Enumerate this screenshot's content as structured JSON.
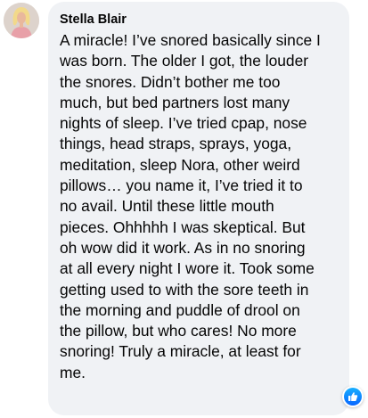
{
  "comment": {
    "author": "Stella Blair",
    "text_lines": [
      "A miracle! I’ve snored basically since I",
      "was born. The older I got, the louder",
      "the snores. Didn’t bother me too",
      "much, but bed partners lost many",
      "nights of sleep. I’ve tried cpap, nose",
      "things, head straps, sprays, yoga,",
      "meditation, sleep Nora, other weird",
      "pillows… you name it, I’ve tried it to",
      "no avail. Until these little mouth",
      "pieces. Ohhhhh I was skeptical. But",
      "oh wow did it work. As in no snoring",
      "at all every night I wore it. Took some",
      "getting used to with the sore teeth in",
      "the morning and puddle of drool on",
      "the pillow, but who cares! No more",
      "snoring! Truly a miracle, at least for",
      "me."
    ],
    "avatar_icon": "profile-photo",
    "reaction_icon": "like-thumbs-up-icon"
  },
  "colors": {
    "bubble_background": "#f0f2f5",
    "text": "#050505",
    "like_blue": "#0866ff"
  }
}
